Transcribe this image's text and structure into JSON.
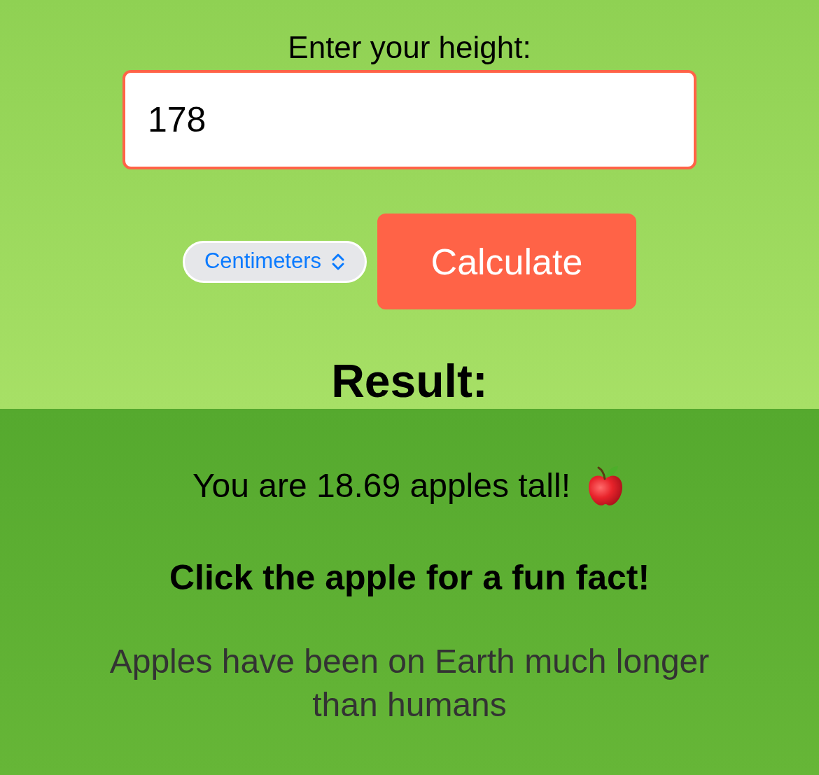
{
  "height_form": {
    "label": "Enter your height:",
    "height_input": {
      "value": "178"
    },
    "unit_select": {
      "value": "Centimeters"
    },
    "calculate_button": {
      "label": "Calculate"
    }
  },
  "result": {
    "heading": "Result:",
    "message": "You are 18.69 apples tall!",
    "prompt": "Click the apple for a fun fact!",
    "fun_fact": "Apples have been on Earth much longer than humans"
  }
}
